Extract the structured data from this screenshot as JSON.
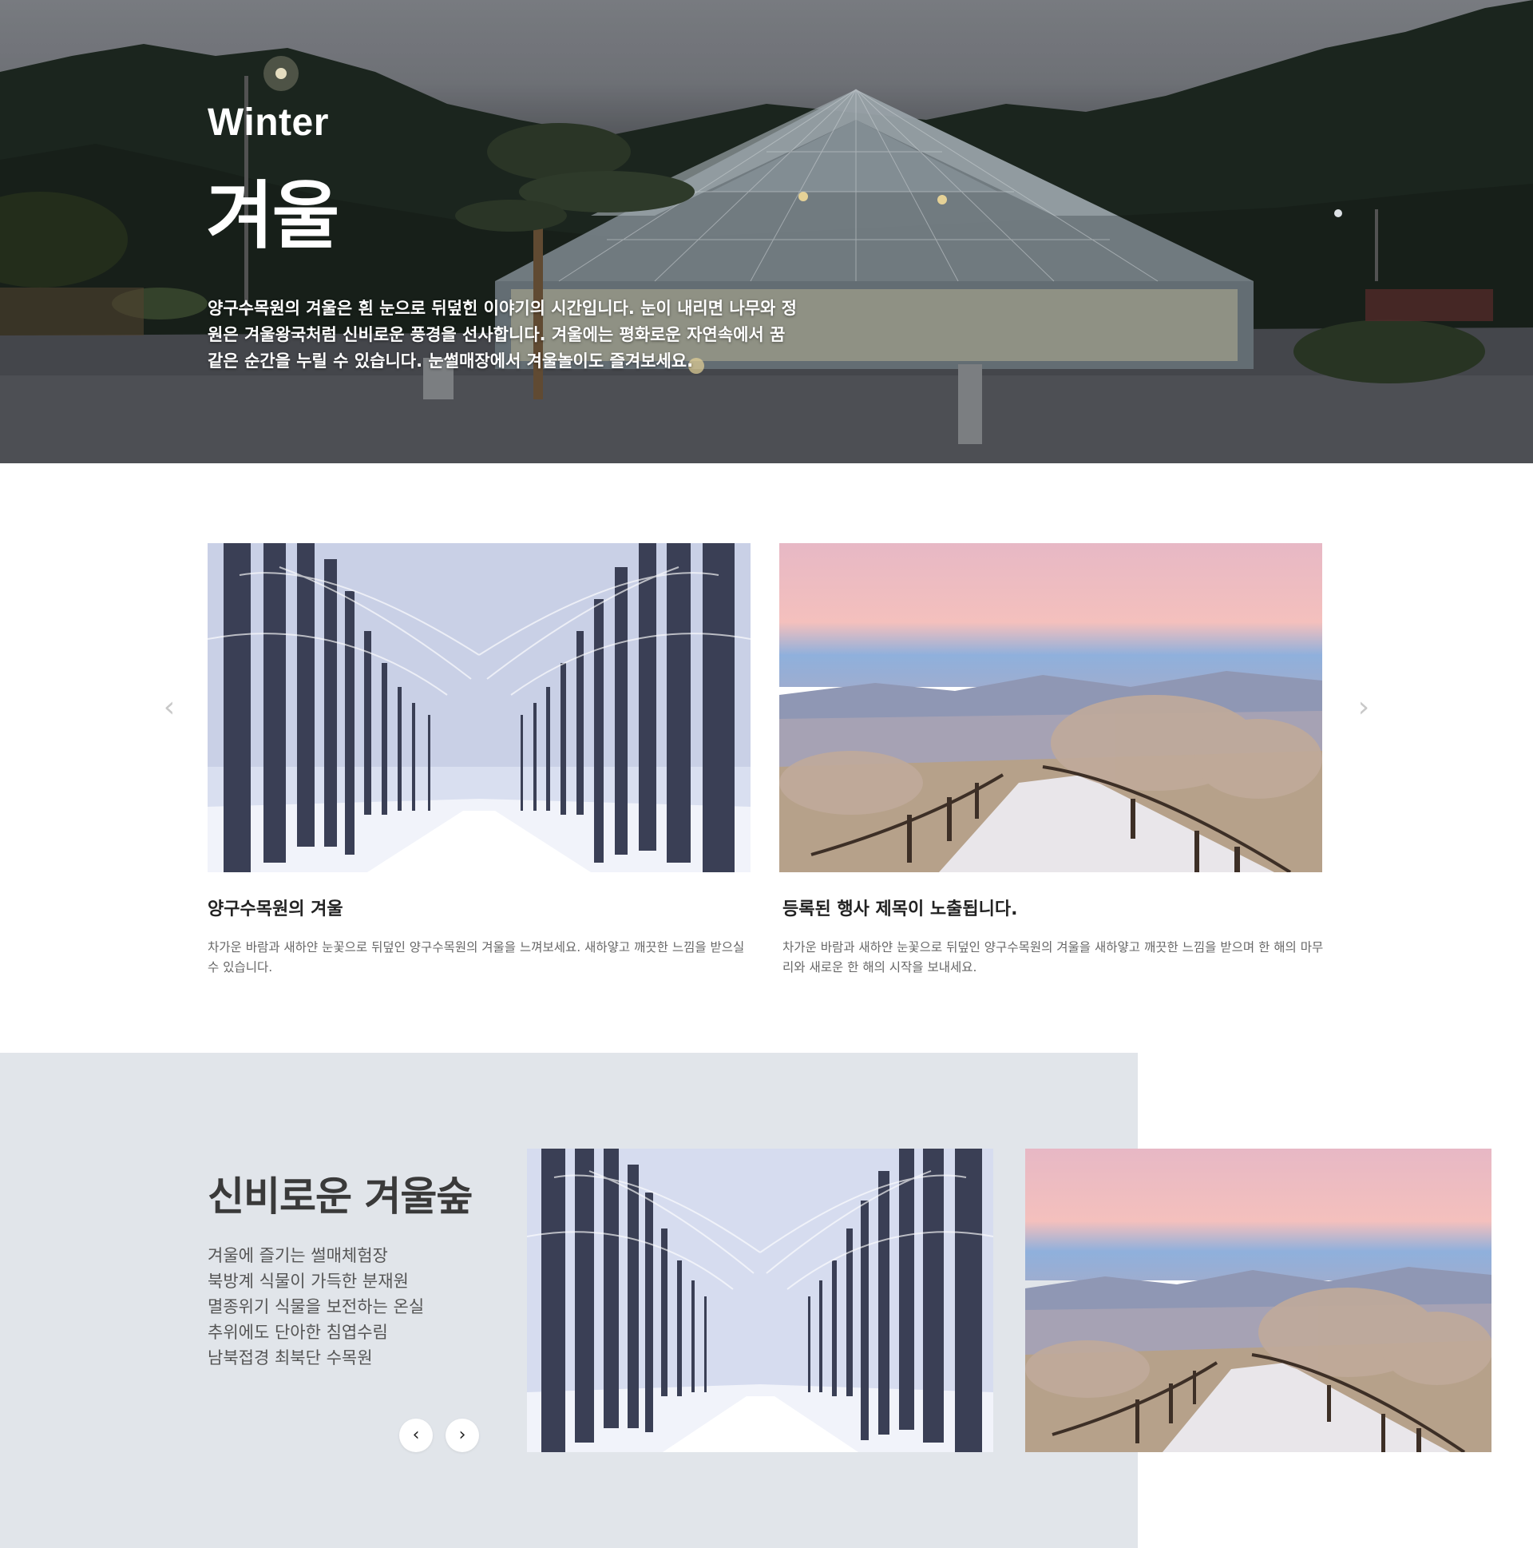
{
  "hero": {
    "season_en": "Winter",
    "season_ko": "겨울",
    "description": "양구수목원의 겨울은 흰 눈으로 뒤덮힌 이야기의 시간입니다. 눈이 내리면 나무와 정원은  겨울왕국처럼 신비로운 풍경을 선사합니다. 겨울에는 평화로운 자연속에서 꿈같은 순간을 누릴 수 있습니다. 눈썰매장에서 겨울놀이도 즐겨보세요."
  },
  "slider": {
    "prev_icon": "chevron-left-icon",
    "prev_glyph": "‹",
    "next_icon": "chevron-right-icon",
    "next_glyph": "›",
    "cards": [
      {
        "image": "snowy-tree-avenue",
        "title": "양구수목원의 겨울",
        "description": "차가운 바람과 새하얀 눈꽃으로 뒤덮인 양구수목원의 겨울을 느껴보세요. 새하얗고 깨끗한 느낌을 받으실 수 있습니다."
      },
      {
        "image": "frosty-mountain-trail",
        "title": "등록된 행사 제목이 노출됩니다.",
        "description": "차가운 바람과 새하얀 눈꽃으로 뒤덮인 양구수목원의 겨울을 새하얗고 깨끗한 느낌을 받으며 한 해의 마무리와 새로운 한 해의 시작을 보내세요."
      }
    ]
  },
  "forest": {
    "title": "신비로운 겨울숲",
    "items": [
      "겨울에 즐기는 썰매체험장",
      "북방계 식물이 가득한 분재원",
      "멸종위기 식물을 보전하는 온실",
      "추위에도 단아한 침엽수림",
      "남북접경 최북단 수목원"
    ],
    "prev_glyph": "‹",
    "next_glyph": "›",
    "images": [
      "snowy-tree-avenue",
      "frosty-mountain-trail"
    ]
  },
  "colors": {
    "forest_bg": "#e1e5ea",
    "arrow_gray": "#c8c8c8",
    "title_dark": "#3a3a3a"
  }
}
